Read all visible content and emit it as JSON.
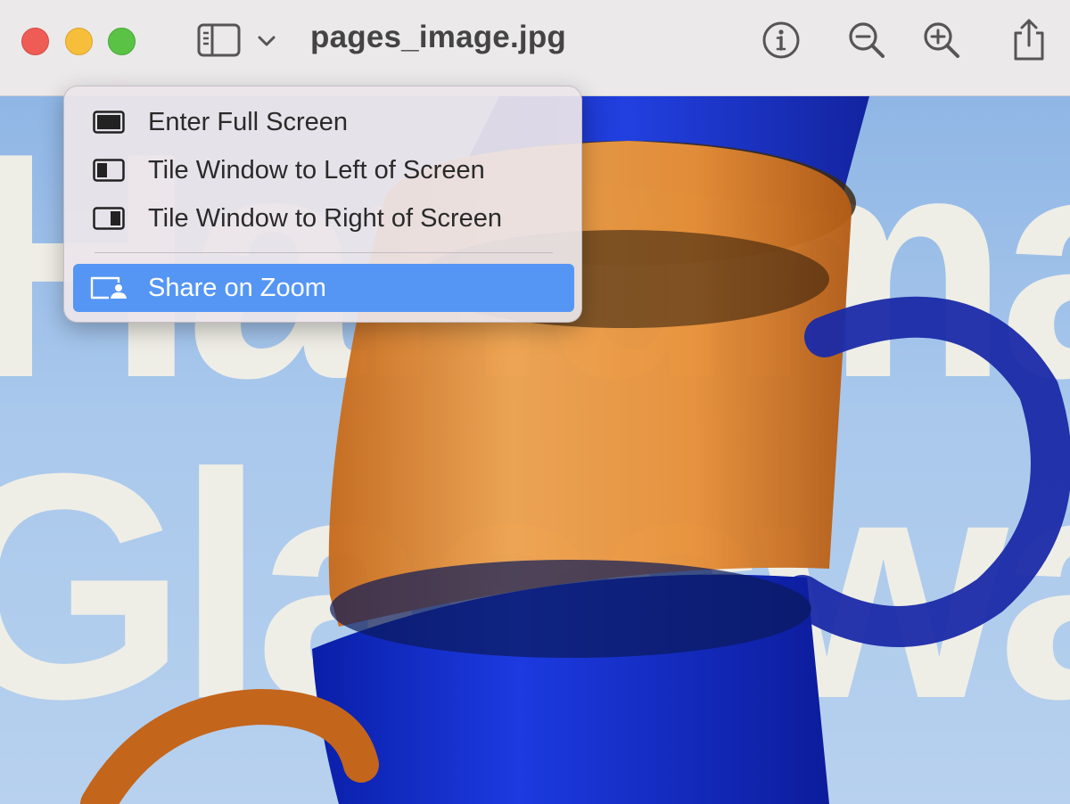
{
  "window": {
    "title": "pages_image.jpg"
  },
  "toolbar": {
    "sidebar_icon": "sidebar-toggle-icon",
    "chevron_icon": "chevron-down-icon",
    "info_icon": "info-icon",
    "zoom_out_icon": "zoom-out-icon",
    "zoom_in_icon": "zoom-in-icon",
    "share_icon": "share-icon"
  },
  "image": {
    "line_1": "Handma",
    "line_2": "Glasswa"
  },
  "menu": {
    "items": [
      {
        "label": "Enter Full Screen",
        "icon": "full-screen-icon"
      },
      {
        "label": "Tile Window to Left of Screen",
        "icon": "tile-left-icon"
      },
      {
        "label": "Tile Window to Right of Screen",
        "icon": "tile-right-icon"
      },
      {
        "label": "Share on Zoom",
        "icon": "share-screen-icon",
        "highlighted": true
      }
    ]
  },
  "colors": {
    "close": "#ee5c55",
    "minimize": "#f7be3c",
    "zoom": "#5ac345",
    "menu_highlight": "#5596f4",
    "glass_blue": "#1530c8",
    "glass_amber": "#e0862c"
  }
}
